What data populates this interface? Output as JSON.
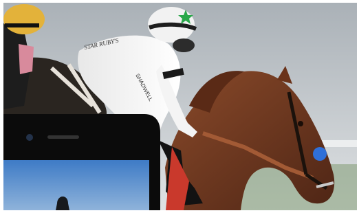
{
  "scene": {
    "kind": "photo",
    "subject": "jockeys racing horses",
    "overlay": "smartphone in lower-left corner"
  },
  "silks": {
    "back_lettering": "STAR RUBY'S",
    "sleeve_lettering": "SHADWELL"
  },
  "phone": {
    "screen_content": "blue sky with silhouette"
  },
  "colors": {
    "sky": "#b9bec3",
    "horse_coat": "#7a3c22",
    "jockey_silks": "#f1f1f1",
    "cap_star": "#2aa84a",
    "bridle_accent": "#2f6fd8",
    "phone_body": "#0b0b0b",
    "phone_screen": "#5f8fc9"
  }
}
